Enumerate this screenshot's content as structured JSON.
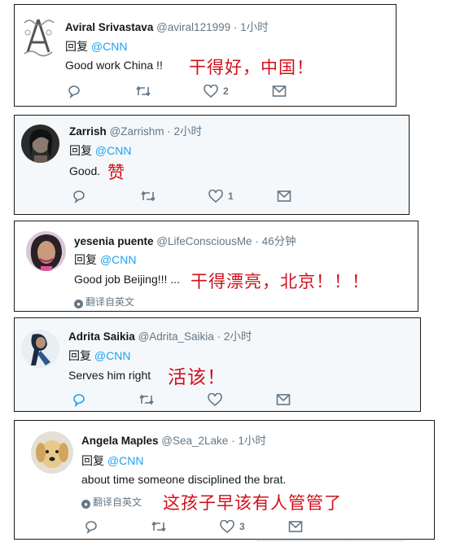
{
  "tweets": [
    {
      "name": "Aviral Srivastava",
      "handle": "@aviral121999",
      "dot": "·",
      "time": "1小时",
      "reply_prefix": "回复",
      "reply_mention": "@CNN",
      "text": "Good work China !!",
      "annotation": "干得好，中国！",
      "like_count": "2",
      "translate": ""
    },
    {
      "name": "Zarrish",
      "handle": "@Zarrishm",
      "dot": "·",
      "time": "2小时",
      "reply_prefix": "回复",
      "reply_mention": "@CNN",
      "text": "Good.",
      "annotation": "赞",
      "like_count": "1",
      "translate": ""
    },
    {
      "name": "yesenia puente",
      "handle": "@LifeConsciousMe",
      "dot": "·",
      "time": "46分钟",
      "reply_prefix": "回复",
      "reply_mention": "@CNN",
      "text": "Good job Beijing!!! ...",
      "annotation": "干得漂亮，北京！！！",
      "like_count": "",
      "translate": "翻译自英文"
    },
    {
      "name": "Adrita Saikia",
      "handle": "@Adrita_Saikia",
      "dot": "·",
      "time": "2小时",
      "reply_prefix": "回复",
      "reply_mention": "@CNN",
      "text": "Serves him right",
      "annotation": "活该！",
      "like_count": "",
      "translate": ""
    },
    {
      "name": "Angela Maples",
      "handle": "@Sea_2Lake",
      "dot": "·",
      "time": "1小时",
      "reply_prefix": "回复",
      "reply_mention": "@CNN",
      "text": "about time someone disciplined the brat.",
      "annotation": "这孩子早该有人管管了",
      "like_count": "3",
      "translate": "翻译自英文"
    }
  ],
  "colors": {
    "annotation_red": "#d0101a",
    "mention_blue": "#1da1f2",
    "muted_gray": "#657786"
  },
  "icons": [
    "reply-icon",
    "retweet-icon",
    "like-icon",
    "message-icon",
    "globe-icon"
  ]
}
